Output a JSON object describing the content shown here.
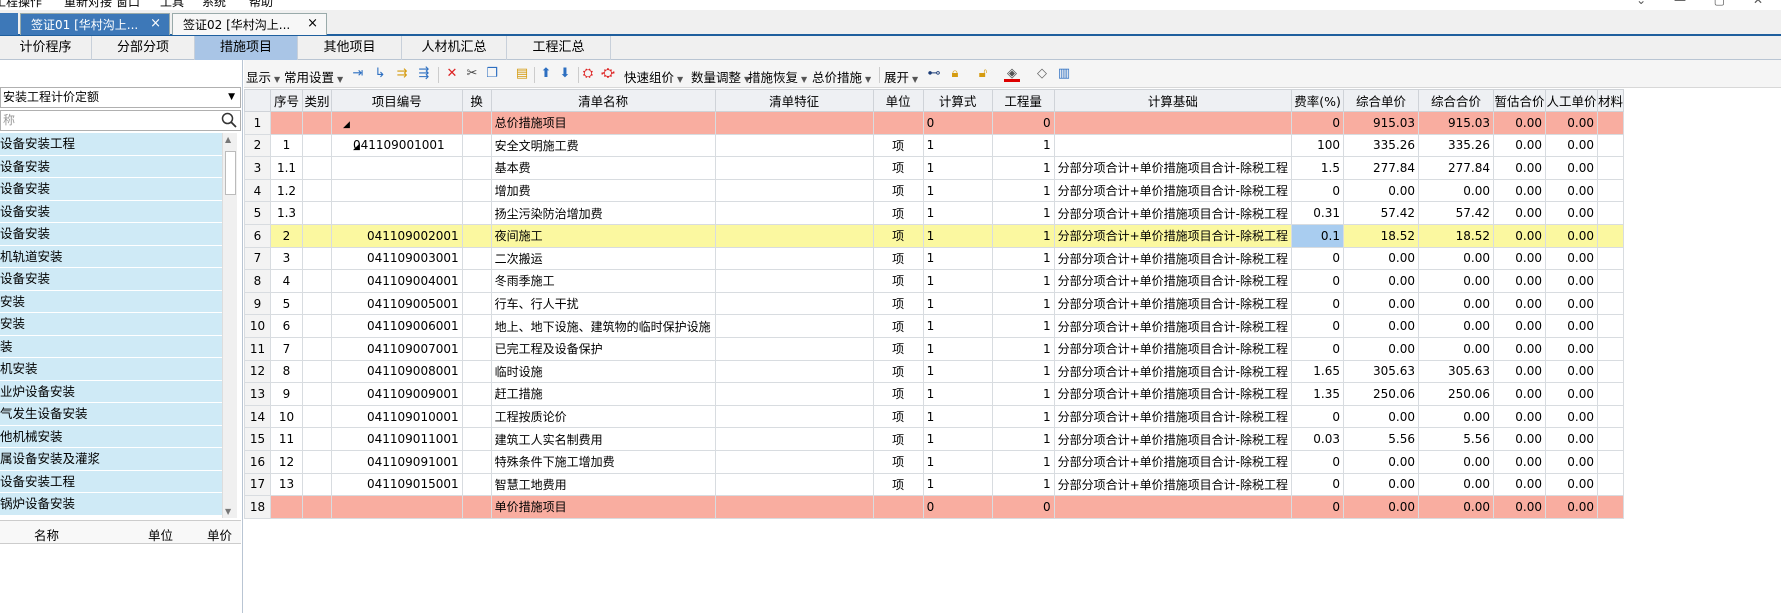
{
  "menu": [
    "工程操作",
    "重新对接",
    "窗口",
    "工具",
    "系统",
    "帮助"
  ],
  "window_controls": "⌄ — ▢ ✕",
  "doc_tabs": [
    {
      "label": "签证01 [华村沟上...",
      "close": "×"
    },
    {
      "label": "签证02 [华村沟上...",
      "close": "×"
    }
  ],
  "nav_tabs": [
    "计价程序",
    "分部分项",
    "措施项目",
    "其他项目",
    "人材机汇总",
    "工程汇总"
  ],
  "nav_active": "措施项目",
  "left": {
    "select_value": "安装工程计价定额",
    "search_placeholder": "称",
    "tree_items": [
      "设备安装工程",
      "设备安装",
      "设备安装",
      "设备安装",
      "设备安装",
      "机轨道安装",
      "设备安装",
      "安装",
      "安装",
      "装",
      "机安装",
      "业炉设备安装",
      "气发生设备安装",
      "他机械安装",
      "属设备安装及灌浆",
      "设备安装工程",
      "锅炉设备安装"
    ],
    "grid_headers": [
      "名称",
      "单位",
      "单价"
    ]
  },
  "toolbar": {
    "show": "显示",
    "common_settings": "常用设置",
    "quick_group": "快速组价",
    "qty_adjust": "数量调整",
    "measure_restore": "措施恢复",
    "total_measure": "总价措施",
    "expand": "展开"
  },
  "table": {
    "headers": [
      "",
      "序号",
      "类别",
      "项目编号",
      "换",
      "清单名称",
      "清单特征",
      "单位",
      "计算式",
      "工程量",
      "计算基础",
      "费率(%)",
      "综合单价",
      "综合合价",
      "暂估合价",
      "人工单价",
      "材料"
    ],
    "rows": [
      {
        "idx": "1",
        "seq": "",
        "cat": "",
        "code": "",
        "tri": "◢",
        "huan": "",
        "name": "总价措施项目",
        "feature": "",
        "unit": "",
        "formula": "0",
        "qty": "0",
        "base": "",
        "rate": "0",
        "unit_price": "915.03",
        "total": "915.03",
        "est": "0.00",
        "labor": "0.00",
        "style": "pink"
      },
      {
        "idx": "2",
        "seq": "1",
        "cat": "",
        "code": "041109001001",
        "tri": "◢",
        "huan": "",
        "name": "安全文明施工费",
        "feature": "",
        "unit": "项",
        "formula": "1",
        "qty": "1",
        "base": "",
        "rate": "100",
        "unit_price": "335.26",
        "total": "335.26",
        "est": "0.00",
        "labor": "0.00",
        "style": ""
      },
      {
        "idx": "3",
        "seq": "1.1",
        "cat": "",
        "code": "",
        "tri": "",
        "huan": "",
        "name": "基本费",
        "feature": "",
        "unit": "项",
        "formula": "1",
        "qty": "1",
        "base": "分部分项合计+单价措施项目合计-除税工程",
        "rate": "1.5",
        "unit_price": "277.84",
        "total": "277.84",
        "est": "0.00",
        "labor": "0.00",
        "style": ""
      },
      {
        "idx": "4",
        "seq": "1.2",
        "cat": "",
        "code": "",
        "tri": "",
        "huan": "",
        "name": "增加费",
        "feature": "",
        "unit": "项",
        "formula": "1",
        "qty": "1",
        "base": "分部分项合计+单价措施项目合计-除税工程",
        "rate": "0",
        "unit_price": "0.00",
        "total": "0.00",
        "est": "0.00",
        "labor": "0.00",
        "style": ""
      },
      {
        "idx": "5",
        "seq": "1.3",
        "cat": "",
        "code": "",
        "tri": "",
        "huan": "",
        "name": "扬尘污染防治增加费",
        "feature": "",
        "unit": "项",
        "formula": "1",
        "qty": "1",
        "base": "分部分项合计+单价措施项目合计-除税工程",
        "rate": "0.31",
        "unit_price": "57.42",
        "total": "57.42",
        "est": "0.00",
        "labor": "0.00",
        "style": ""
      },
      {
        "idx": "6",
        "seq": "2",
        "cat": "",
        "code": "041109002001",
        "tri": "",
        "huan": "",
        "name": "夜间施工",
        "feature": "",
        "unit": "项",
        "formula": "1",
        "qty": "1",
        "base": "分部分项合计+单价措施项目合计-除税工程",
        "rate": "0.1",
        "unit_price": "18.52",
        "total": "18.52",
        "est": "0.00",
        "labor": "0.00",
        "style": "yellow"
      },
      {
        "idx": "7",
        "seq": "3",
        "cat": "",
        "code": "041109003001",
        "tri": "",
        "huan": "",
        "name": "二次搬运",
        "feature": "",
        "unit": "项",
        "formula": "1",
        "qty": "1",
        "base": "分部分项合计+单价措施项目合计-除税工程",
        "rate": "0",
        "unit_price": "0.00",
        "total": "0.00",
        "est": "0.00",
        "labor": "0.00",
        "style": ""
      },
      {
        "idx": "8",
        "seq": "4",
        "cat": "",
        "code": "041109004001",
        "tri": "",
        "huan": "",
        "name": "冬雨季施工",
        "feature": "",
        "unit": "项",
        "formula": "1",
        "qty": "1",
        "base": "分部分项合计+单价措施项目合计-除税工程",
        "rate": "0",
        "unit_price": "0.00",
        "total": "0.00",
        "est": "0.00",
        "labor": "0.00",
        "style": ""
      },
      {
        "idx": "9",
        "seq": "5",
        "cat": "",
        "code": "041109005001",
        "tri": "",
        "huan": "",
        "name": "行车、行人干扰",
        "feature": "",
        "unit": "项",
        "formula": "1",
        "qty": "1",
        "base": "分部分项合计+单价措施项目合计-除税工程",
        "rate": "0",
        "unit_price": "0.00",
        "total": "0.00",
        "est": "0.00",
        "labor": "0.00",
        "style": ""
      },
      {
        "idx": "10",
        "seq": "6",
        "cat": "",
        "code": "041109006001",
        "tri": "",
        "huan": "",
        "name": "地上、地下设施、建筑物的临时保护设施",
        "feature": "",
        "unit": "项",
        "formula": "1",
        "qty": "1",
        "base": "分部分项合计+单价措施项目合计-除税工程",
        "rate": "0",
        "unit_price": "0.00",
        "total": "0.00",
        "est": "0.00",
        "labor": "0.00",
        "style": ""
      },
      {
        "idx": "11",
        "seq": "7",
        "cat": "",
        "code": "041109007001",
        "tri": "",
        "huan": "",
        "name": "已完工程及设备保护",
        "feature": "",
        "unit": "项",
        "formula": "1",
        "qty": "1",
        "base": "分部分项合计+单价措施项目合计-除税工程",
        "rate": "0",
        "unit_price": "0.00",
        "total": "0.00",
        "est": "0.00",
        "labor": "0.00",
        "style": ""
      },
      {
        "idx": "12",
        "seq": "8",
        "cat": "",
        "code": "041109008001",
        "tri": "",
        "huan": "",
        "name": "临时设施",
        "feature": "",
        "unit": "项",
        "formula": "1",
        "qty": "1",
        "base": "分部分项合计+单价措施项目合计-除税工程",
        "rate": "1.65",
        "unit_price": "305.63",
        "total": "305.63",
        "est": "0.00",
        "labor": "0.00",
        "style": ""
      },
      {
        "idx": "13",
        "seq": "9",
        "cat": "",
        "code": "041109009001",
        "tri": "",
        "huan": "",
        "name": "赶工措施",
        "feature": "",
        "unit": "项",
        "formula": "1",
        "qty": "1",
        "base": "分部分项合计+单价措施项目合计-除税工程",
        "rate": "1.35",
        "unit_price": "250.06",
        "total": "250.06",
        "est": "0.00",
        "labor": "0.00",
        "style": ""
      },
      {
        "idx": "14",
        "seq": "10",
        "cat": "",
        "code": "041109010001",
        "tri": "",
        "huan": "",
        "name": "工程按质论价",
        "feature": "",
        "unit": "项",
        "formula": "1",
        "qty": "1",
        "base": "分部分项合计+单价措施项目合计-除税工程",
        "rate": "0",
        "unit_price": "0.00",
        "total": "0.00",
        "est": "0.00",
        "labor": "0.00",
        "style": ""
      },
      {
        "idx": "15",
        "seq": "11",
        "cat": "",
        "code": "041109011001",
        "tri": "",
        "huan": "",
        "name": "建筑工人实名制费用",
        "feature": "",
        "unit": "项",
        "formula": "1",
        "qty": "1",
        "base": "分部分项合计+单价措施项目合计-除税工程",
        "rate": "0.03",
        "unit_price": "5.56",
        "total": "5.56",
        "est": "0.00",
        "labor": "0.00",
        "style": ""
      },
      {
        "idx": "16",
        "seq": "12",
        "cat": "",
        "code": "041109091001",
        "tri": "",
        "huan": "",
        "name": "特殊条件下施工增加费",
        "feature": "",
        "unit": "项",
        "formula": "1",
        "qty": "1",
        "base": "分部分项合计+单价措施项目合计-除税工程",
        "rate": "0",
        "unit_price": "0.00",
        "total": "0.00",
        "est": "0.00",
        "labor": "0.00",
        "style": ""
      },
      {
        "idx": "17",
        "seq": "13",
        "cat": "",
        "code": "041109015001",
        "tri": "",
        "huan": "",
        "name": "智慧工地费用",
        "feature": "",
        "unit": "项",
        "formula": "1",
        "qty": "1",
        "base": "分部分项合计+单价措施项目合计-除税工程",
        "rate": "0",
        "unit_price": "0.00",
        "total": "0.00",
        "est": "0.00",
        "labor": "0.00",
        "style": ""
      },
      {
        "idx": "18",
        "seq": "",
        "cat": "",
        "code": "",
        "tri": "",
        "huan": "",
        "name": "单价措施项目",
        "feature": "",
        "unit": "",
        "formula": "0",
        "qty": "0",
        "base": "",
        "rate": "0",
        "unit_price": "0.00",
        "total": "0.00",
        "est": "0.00",
        "labor": "0.00",
        "style": "pink"
      }
    ]
  },
  "colors": {
    "active_tab": "#3d78b8",
    "nav_active": "#a9c5e6",
    "pink_row": "#f9ada0",
    "yellow_row": "#fbf8a0",
    "selected_cell": "#a9cdf0",
    "tree_bg": "#cfeaf6"
  }
}
